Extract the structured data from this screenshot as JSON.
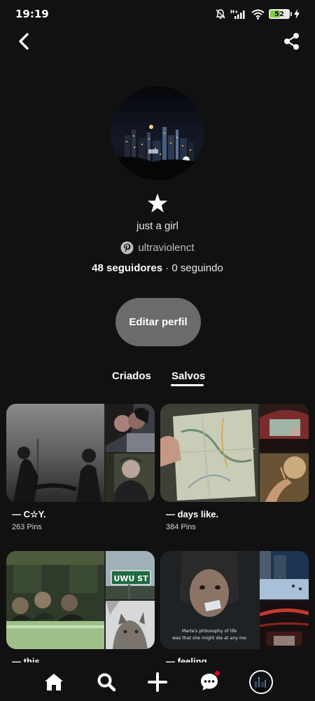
{
  "status_bar": {
    "time": "19:19",
    "network": "H+",
    "battery_level": "52",
    "battery_fraction": 0.52,
    "icons": [
      "bell-off-icon",
      "signal-icon",
      "wifi-icon",
      "battery-icon",
      "charging-icon"
    ]
  },
  "header": {
    "back_icon": "chevron-left-icon",
    "share_icon": "share-icon"
  },
  "profile": {
    "avatar_description_icon": "city-night-avatar",
    "badge_icon": "star-icon",
    "display_name": "just a girl",
    "username": "ultraviolenct",
    "followers_count": "48 seguidores",
    "separator": " · ",
    "following_count": "0 seguindo",
    "edit_button": "Editar perfil"
  },
  "tabs": [
    {
      "label": "Criados",
      "active": false
    },
    {
      "label": "Salvos",
      "active": true
    }
  ],
  "boards": [
    {
      "title": "— C☆Y.",
      "count": "263 Pins"
    },
    {
      "title": "— days like.",
      "count": "384 Pins"
    },
    {
      "title": "— this",
      "count": ""
    },
    {
      "title": "— feeling.",
      "count": ""
    }
  ],
  "board_image_text": {
    "street_sign": "UWU ST",
    "movie_caption_line1": "Marla's philosophy of life",
    "movie_caption_line2": "was that she might die at any mo"
  },
  "bottom_nav": {
    "items": [
      "home-icon",
      "search-icon",
      "plus-icon",
      "messages-icon",
      "profile-avatar"
    ],
    "notification_color": "#e60023"
  },
  "colors": {
    "background": "#111111",
    "button": "#6b6b6b",
    "text": "#ffffff"
  }
}
